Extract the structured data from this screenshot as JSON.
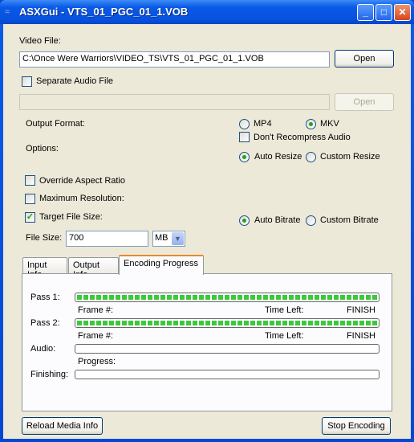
{
  "window": {
    "title": "ASXGui - VTS_01_PGC_01_1.VOB",
    "app_icon": "asxgui-icon",
    "minimize": "minimize-icon",
    "maximize": "maximize-icon",
    "close": "close-icon"
  },
  "video_file": {
    "label": "Video File:",
    "value": "C:\\Once Were Warriors\\VIDEO_TS\\VTS_01_PGC_01_1.VOB",
    "open_label": "Open"
  },
  "audio_file": {
    "checkbox_label": "Separate Audio File",
    "checked": false,
    "value": "",
    "open_label": "Open",
    "disabled": true
  },
  "output_format": {
    "label": "Output Format:",
    "options": [
      "MP4",
      "MKV"
    ],
    "selected": "MKV",
    "dont_recompress_label": "Don't Recompress Audio",
    "dont_recompress_checked": false
  },
  "options": {
    "label": "Options:",
    "resize_options": [
      "Auto Resize",
      "Custom Resize"
    ],
    "resize_selected": "Auto Resize"
  },
  "override_aspect": {
    "label": "Override Aspect Ratio",
    "checked": false
  },
  "max_resolution": {
    "label": "Maximum Resolution:",
    "checked": false
  },
  "target_file_size": {
    "label": "Target File Size:",
    "checked": true
  },
  "bitrate": {
    "options": [
      "Auto Bitrate",
      "Custom Bitrate"
    ],
    "selected": "Auto Bitrate"
  },
  "file_size": {
    "label": "File Size:",
    "value": "700",
    "unit": "MB"
  },
  "tabs": [
    {
      "label": "Input Info"
    },
    {
      "label": "Output Info"
    },
    {
      "label": "Encoding Progress",
      "selected": true
    }
  ],
  "progress": {
    "pass1": {
      "label": "Pass 1:",
      "percent": 100,
      "frame_label": "Frame #:",
      "time_left_label": "Time Left:",
      "time_left": "FINISH"
    },
    "pass2": {
      "label": "Pass 2:",
      "percent": 100,
      "frame_label": "Frame #:",
      "time_left_label": "Time Left:",
      "time_left": "FINISH"
    },
    "audio": {
      "label": "Audio:",
      "percent": 0,
      "progress_label": "Progress:"
    },
    "finishing": {
      "label": "Finishing:",
      "percent": 0
    }
  },
  "colors": {
    "progress_fill": "#3cc83c",
    "titlebar": "#0a5ae6",
    "tab_highlight": "#e68b2c"
  },
  "buttons": {
    "reload": "Reload Media Info",
    "stop": "Stop Encoding"
  }
}
